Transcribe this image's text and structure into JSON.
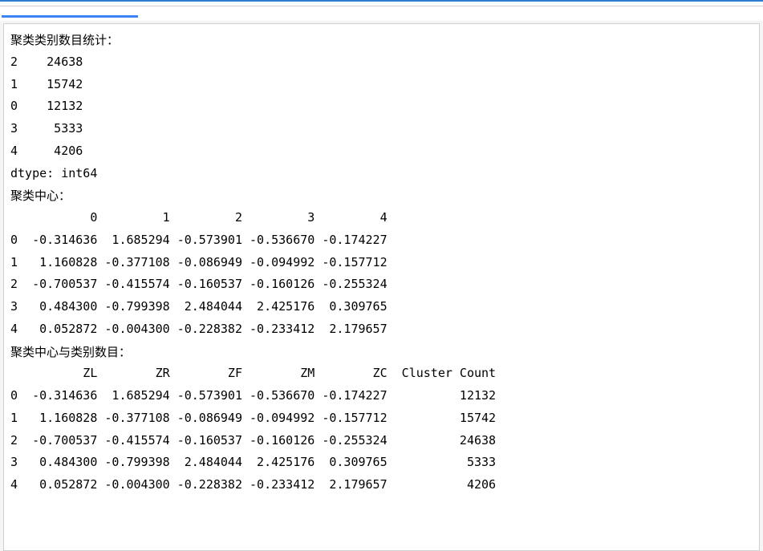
{
  "labels": {
    "cluster_count_header": "聚类类别数目统计：",
    "centers_header": "聚类中心：",
    "centers_with_counts_header": "聚类中心与类别数目：",
    "dtype_line": "dtype: int64"
  },
  "counts": [
    {
      "idx": "2",
      "count": 24638
    },
    {
      "idx": "1",
      "count": 15742
    },
    {
      "idx": "0",
      "count": 12132
    },
    {
      "idx": "3",
      "count": 5333
    },
    {
      "idx": "4",
      "count": 4206
    }
  ],
  "centers": {
    "columns": [
      "0",
      "1",
      "2",
      "3",
      "4"
    ],
    "rows": [
      {
        "idx": "0",
        "vals": [
          "-0.314636",
          " 1.685294",
          "-0.573901",
          "-0.536670",
          "-0.174227"
        ]
      },
      {
        "idx": "1",
        "vals": [
          " 1.160828",
          "-0.377108",
          "-0.086949",
          "-0.094992",
          "-0.157712"
        ]
      },
      {
        "idx": "2",
        "vals": [
          "-0.700537",
          "-0.415574",
          "-0.160537",
          "-0.160126",
          "-0.255324"
        ]
      },
      {
        "idx": "3",
        "vals": [
          " 0.484300",
          "-0.799398",
          " 2.484044",
          " 2.425176",
          " 0.309765"
        ]
      },
      {
        "idx": "4",
        "vals": [
          " 0.052872",
          "-0.004300",
          "-0.228382",
          "-0.233412",
          " 2.179657"
        ]
      }
    ]
  },
  "centers_counts": {
    "columns": [
      "ZL",
      "ZR",
      "ZF",
      "ZM",
      "ZC",
      "Cluster Count"
    ],
    "rows": [
      {
        "idx": "0",
        "vals": [
          "-0.314636",
          " 1.685294",
          "-0.573901",
          "-0.536670",
          "-0.174227"
        ],
        "cluster_count": 12132
      },
      {
        "idx": "1",
        "vals": [
          " 1.160828",
          "-0.377108",
          "-0.086949",
          "-0.094992",
          "-0.157712"
        ],
        "cluster_count": 15742
      },
      {
        "idx": "2",
        "vals": [
          "-0.700537",
          "-0.415574",
          "-0.160537",
          "-0.160126",
          "-0.255324"
        ],
        "cluster_count": 24638
      },
      {
        "idx": "3",
        "vals": [
          " 0.484300",
          "-0.799398",
          " 2.484044",
          " 2.425176",
          " 0.309765"
        ],
        "cluster_count": 5333
      },
      {
        "idx": "4",
        "vals": [
          " 0.052872",
          "-0.004300",
          "-0.228382",
          "-0.233412",
          " 2.179657"
        ],
        "cluster_count": 4206
      }
    ]
  }
}
